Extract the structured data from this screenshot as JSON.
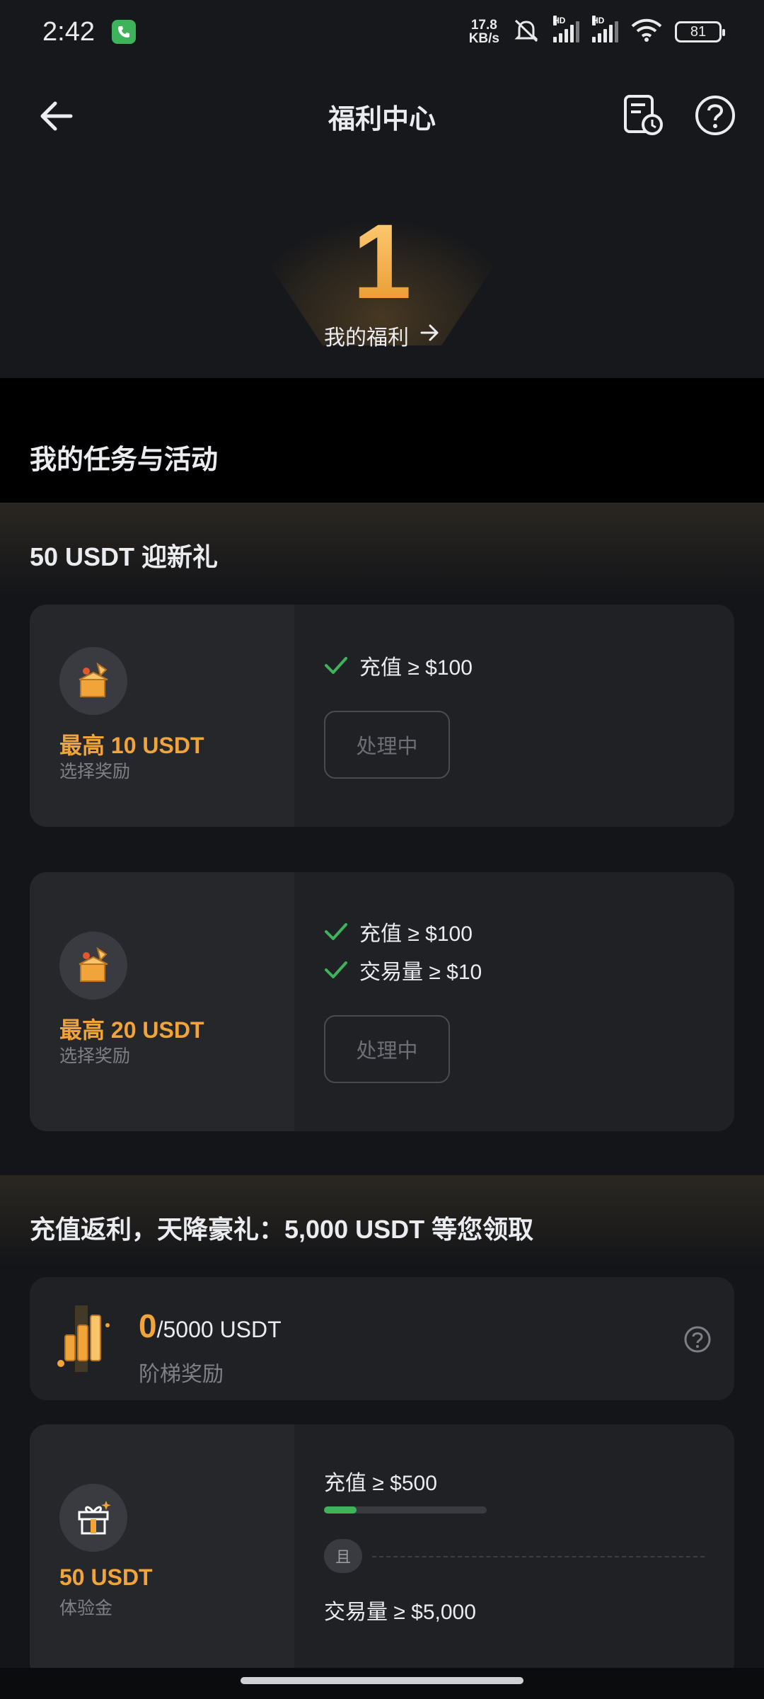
{
  "status_bar": {
    "time": "2:42",
    "net_speed_value": "17.8",
    "net_speed_unit": "KB/s",
    "hd_label": "HD",
    "battery": "81"
  },
  "header": {
    "title": "福利中心"
  },
  "hero": {
    "count": "1",
    "link_label": "我的福利"
  },
  "tasks_section": {
    "title": "我的任务与活动"
  },
  "welcome_group": {
    "title": "50 USDT 迎新礼",
    "cards": [
      {
        "reward": "最高 10 USDT",
        "reward_sub": "选择奖励",
        "conditions": [
          "充值 ≥ $100"
        ],
        "status": "处理中"
      },
      {
        "reward": "最高 20 USDT",
        "reward_sub": "选择奖励",
        "conditions": [
          "充值 ≥ $100",
          "交易量 ≥ $10"
        ],
        "status": "处理中"
      }
    ]
  },
  "rebate_group": {
    "title": "充值返利，天降豪礼：5,000 USDT 等您领取",
    "tier": {
      "current": "0",
      "total": "/5000 USDT",
      "label": "阶梯奖励"
    },
    "trial_card": {
      "reward": "50 USDT",
      "reward_sub": "体验金",
      "condition1": "充值 ≥ $500",
      "condition1_progress": 0.2,
      "and_label": "且",
      "condition2": "交易量 ≥ $5,000"
    }
  },
  "colors": {
    "accent_gold": "#f0a43a",
    "success_green": "#3fb35a",
    "card_bg": "#202125"
  }
}
